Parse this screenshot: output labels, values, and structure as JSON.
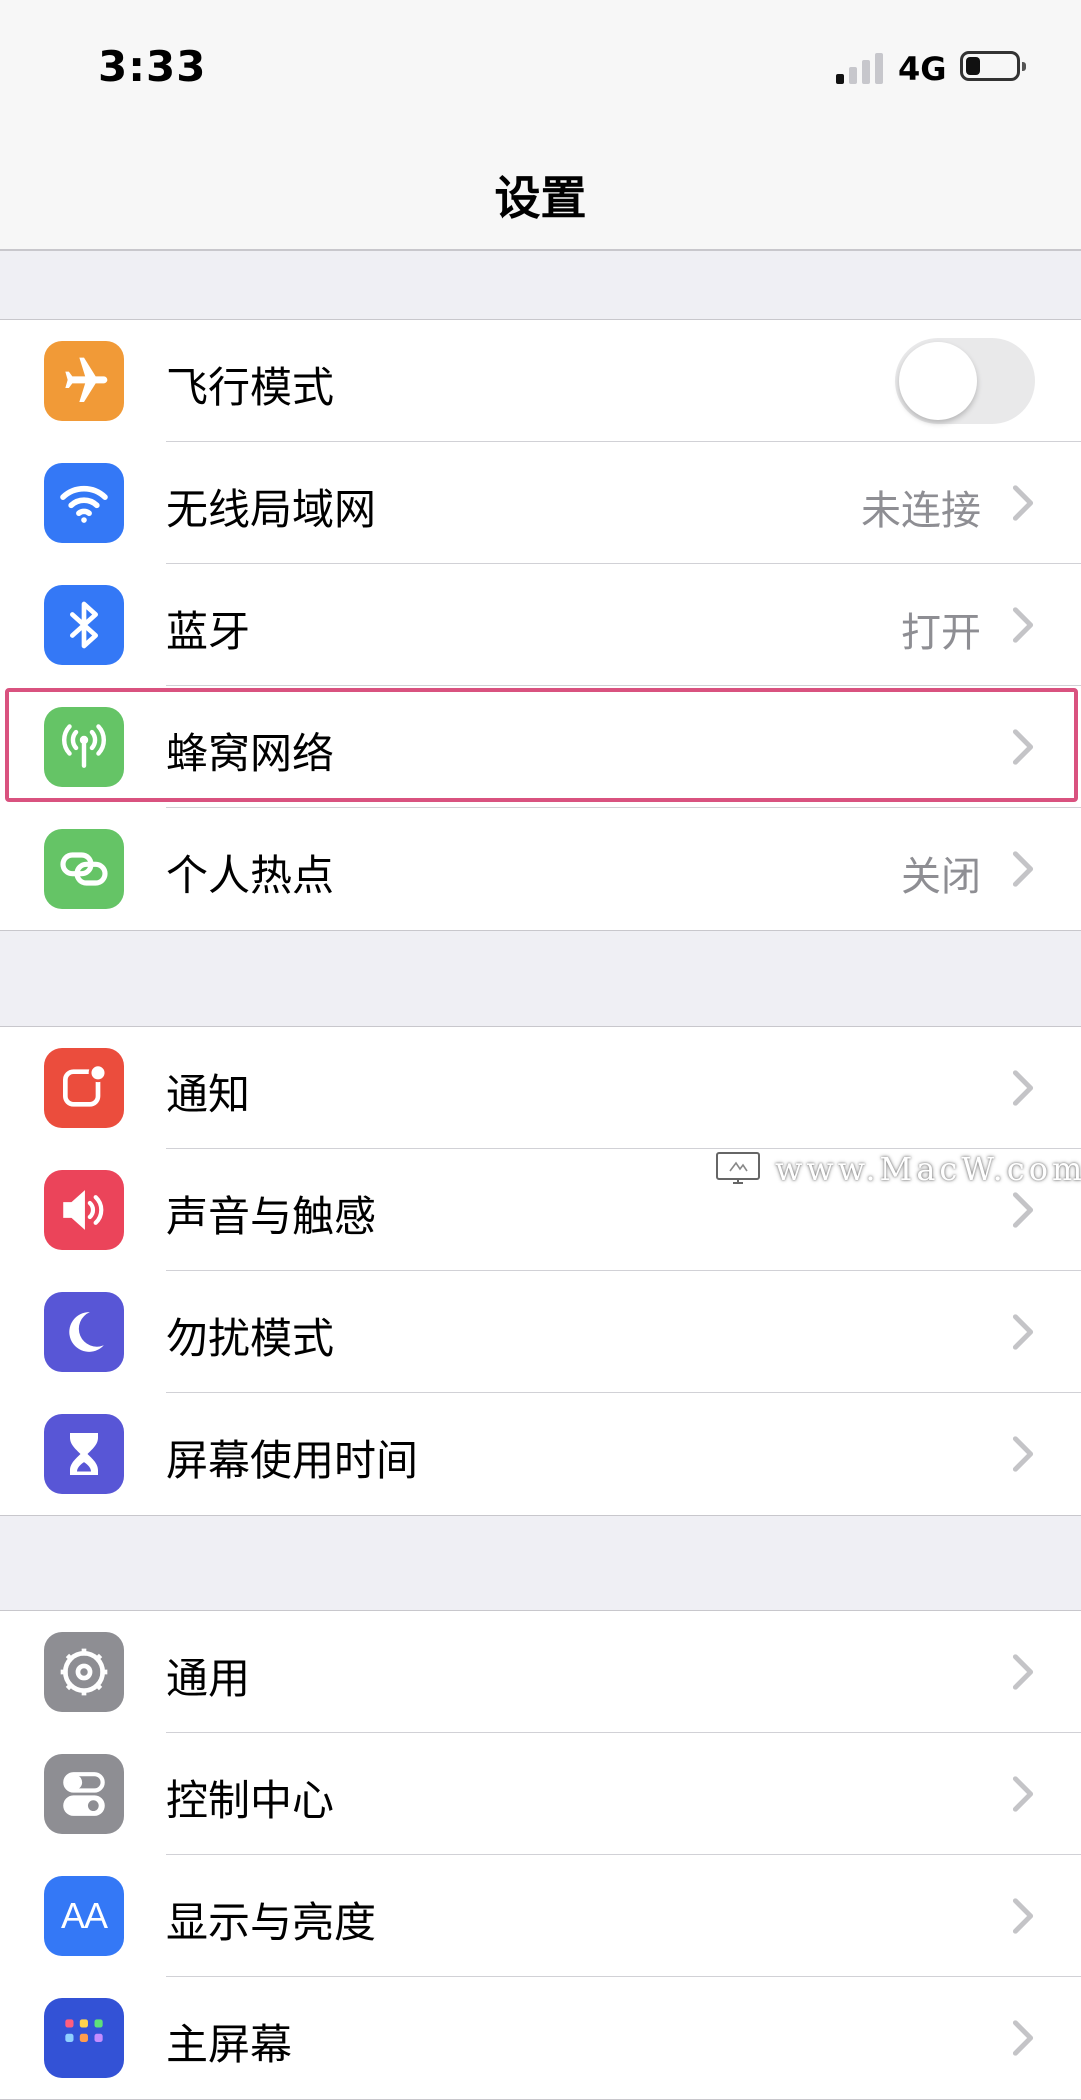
{
  "status_bar": {
    "time": "3:33",
    "network": "4G"
  },
  "nav": {
    "title": "设置"
  },
  "groups": [
    {
      "rows": [
        {
          "label": "飞行模式",
          "icon": "airplane-icon",
          "icon_color": "#f19a37",
          "toggle": false
        },
        {
          "label": "无线局域网",
          "value": "未连接",
          "icon": "wifi-icon",
          "icon_color": "#3478f6"
        },
        {
          "label": "蓝牙",
          "value": "打开",
          "icon": "bluetooth-icon",
          "icon_color": "#3478f6"
        },
        {
          "label": "蜂窝网络",
          "value": "",
          "icon": "cellular-antenna-icon",
          "icon_color": "#65c466",
          "highlighted": true
        },
        {
          "label": "个人热点",
          "value": "关闭",
          "icon": "hotspot-chain-icon",
          "icon_color": "#65c466"
        }
      ]
    },
    {
      "rows": [
        {
          "label": "通知",
          "icon": "notification-icon",
          "icon_color": "#eb4d3d"
        },
        {
          "label": "声音与触感",
          "icon": "speaker-icon",
          "icon_color": "#eb445a"
        },
        {
          "label": "勿扰模式",
          "icon": "moon-icon",
          "icon_color": "#5856d6"
        },
        {
          "label": "屏幕使用时间",
          "icon": "hourglass-icon",
          "icon_color": "#5856d6"
        }
      ]
    },
    {
      "rows": [
        {
          "label": "通用",
          "icon": "gear-icon",
          "icon_color": "#8e8e93"
        },
        {
          "label": "控制中心",
          "icon": "switches-icon",
          "icon_color": "#8e8e93"
        },
        {
          "label": "显示与亮度",
          "icon": "text-size-icon",
          "icon_color": "#3478f6"
        },
        {
          "label": "主屏幕",
          "icon": "home-screen-icon",
          "icon_color": "#3352d6"
        }
      ]
    }
  ],
  "icon_text": {
    "display": "AA"
  },
  "watermark": {
    "text": "www.MacW.com"
  },
  "colors": {
    "highlight_border": "#d9527f",
    "secondary_text": "#8e8e93",
    "background": "#efeff4"
  }
}
